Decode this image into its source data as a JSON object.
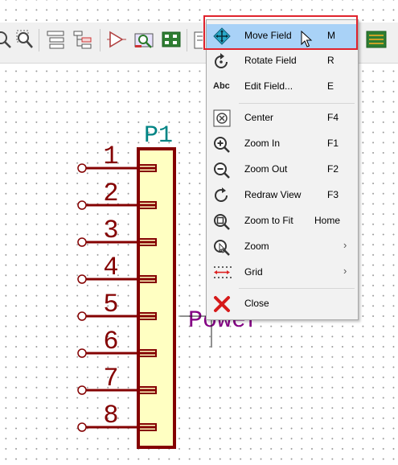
{
  "symbol": {
    "reference": "P1",
    "pin_numbers": [
      "1",
      "2",
      "3",
      "4",
      "5",
      "6",
      "7",
      "8"
    ],
    "net_label": "Power"
  },
  "context_menu": {
    "items": [
      {
        "label": "Move Field",
        "shortcut": "M",
        "icon": "move-icon",
        "highlighted": true
      },
      {
        "label": "Rotate Field",
        "shortcut": "R",
        "icon": "rotate-icon"
      },
      {
        "label": "Edit Field...",
        "shortcut": "E",
        "icon": "abc-text-icon",
        "icon_text": "Abc"
      },
      {
        "label": "Center",
        "shortcut": "F4",
        "icon": "center-icon"
      },
      {
        "label": "Zoom In",
        "shortcut": "F1",
        "icon": "zoom-in-icon"
      },
      {
        "label": "Zoom Out",
        "shortcut": "F2",
        "icon": "zoom-out-icon"
      },
      {
        "label": "Redraw View",
        "shortcut": "F3",
        "icon": "redraw-icon"
      },
      {
        "label": "Zoom to Fit",
        "shortcut": "Home",
        "icon": "zoom-fit-icon"
      },
      {
        "label": "Zoom",
        "shortcut": "›",
        "icon": "zoom-cursor-icon",
        "submenu": true
      },
      {
        "label": "Grid",
        "shortcut": "›",
        "icon": "grid-icon",
        "submenu": true
      },
      {
        "label": "Close",
        "shortcut": "",
        "icon": "close-icon"
      }
    ]
  },
  "toolbar": {
    "icons": [
      "zoom-icon",
      "zoom-selection-icon",
      "hierarchy-icon",
      "hierarchy-nav-icon",
      "erc-icon",
      "library-browser-icon",
      "netlist-icon",
      "annotate-icon",
      "pcb-icon"
    ]
  },
  "colors": {
    "symbol_outline": "#840000",
    "symbol_fill": "#ffffc2",
    "reference_text": "#008484",
    "net_label": "#840084",
    "menu_highlight": "#a9d2f7",
    "annotation_box": "#e0232d"
  }
}
